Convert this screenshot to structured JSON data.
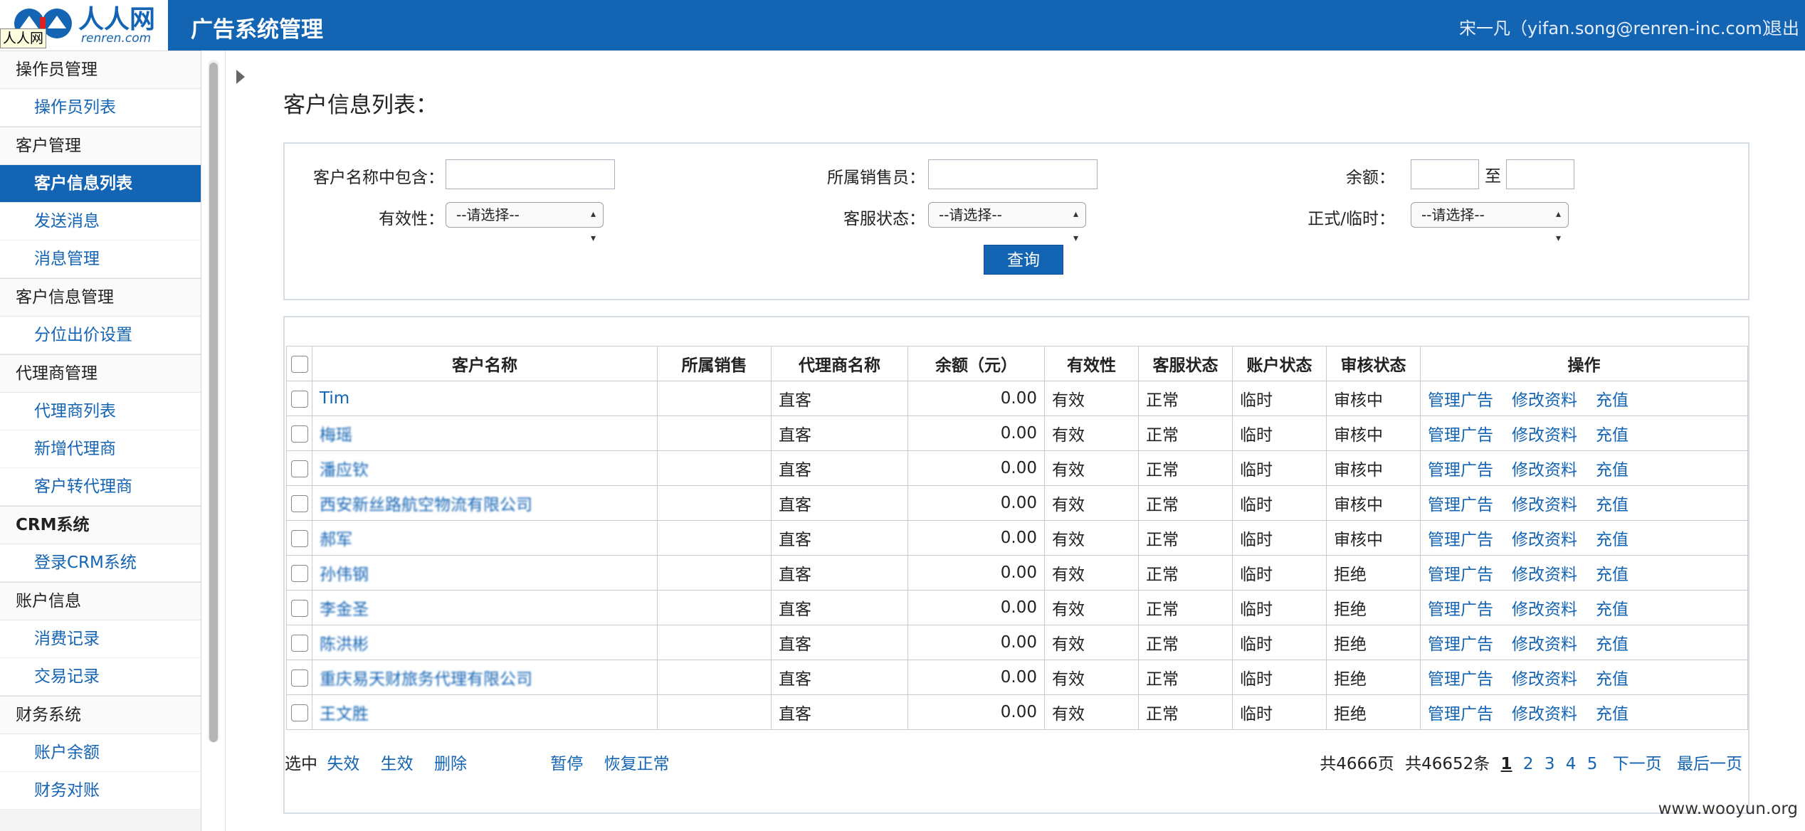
{
  "header": {
    "logo_text": "人人网",
    "logo_sub": "renren.com",
    "logo_tooltip": "人人网",
    "app_title": "广告系统管理",
    "user": "宋一凡（yifan.song@renren-inc.com）",
    "logout": "退出"
  },
  "sidebar": {
    "sections": [
      {
        "title": "操作员管理",
        "items": [
          {
            "label": "操作员列表"
          }
        ]
      },
      {
        "title": "客户管理",
        "items": [
          {
            "label": "客户信息列表",
            "active": true
          },
          {
            "label": "发送消息"
          },
          {
            "label": "消息管理"
          }
        ]
      },
      {
        "title": "客户信息管理",
        "items": [
          {
            "label": "分位出价设置"
          }
        ]
      },
      {
        "title": "代理商管理",
        "items": [
          {
            "label": "代理商列表"
          },
          {
            "label": "新增代理商"
          },
          {
            "label": "客户转代理商"
          }
        ]
      },
      {
        "title": "CRM系统",
        "items": [
          {
            "label": "登录CRM系统"
          }
        ]
      },
      {
        "title": "账户信息",
        "items": [
          {
            "label": "消费记录"
          },
          {
            "label": "交易记录"
          }
        ]
      },
      {
        "title": "财务系统",
        "items": [
          {
            "label": "账户余额"
          },
          {
            "label": "财务对账"
          }
        ]
      }
    ]
  },
  "page_title": "客户信息列表：",
  "search": {
    "name_label": "客户名称中包含：",
    "sales_label": "所属销售员：",
    "balance_label": "余额：",
    "balance_to": "至",
    "validity_label": "有效性：",
    "cs_status_label": "客服状态：",
    "formal_label": "正式/临时：",
    "select_placeholder": "--请选择--",
    "query_button": "查询"
  },
  "table": {
    "headers": [
      "客户名称",
      "所属销售",
      "代理商名称",
      "余额（元）",
      "有效性",
      "客服状态",
      "账户状态",
      "审核状态",
      "操作"
    ],
    "ops": [
      "管理广告",
      "修改资料",
      "充值"
    ],
    "rows": [
      {
        "name": "Tim",
        "sales": "",
        "agent": "直客",
        "balance": "0.00",
        "validity": "有效",
        "cs": "正常",
        "account": "临时",
        "audit": "审核中"
      },
      {
        "name": "梅瑶",
        "sales": "",
        "agent": "直客",
        "balance": "0.00",
        "validity": "有效",
        "cs": "正常",
        "account": "临时",
        "audit": "审核中"
      },
      {
        "name": "潘应钦",
        "sales": "",
        "agent": "直客",
        "balance": "0.00",
        "validity": "有效",
        "cs": "正常",
        "account": "临时",
        "audit": "审核中"
      },
      {
        "name": "西安新丝路航空物流有限公司",
        "sales": "",
        "agent": "直客",
        "balance": "0.00",
        "validity": "有效",
        "cs": "正常",
        "account": "临时",
        "audit": "审核中"
      },
      {
        "name": "郝军",
        "sales": "",
        "agent": "直客",
        "balance": "0.00",
        "validity": "有效",
        "cs": "正常",
        "account": "临时",
        "audit": "审核中"
      },
      {
        "name": "孙伟钢",
        "sales": "",
        "agent": "直客",
        "balance": "0.00",
        "validity": "有效",
        "cs": "正常",
        "account": "临时",
        "audit": "拒绝"
      },
      {
        "name": "李金圣",
        "sales": "",
        "agent": "直客",
        "balance": "0.00",
        "validity": "有效",
        "cs": "正常",
        "account": "临时",
        "audit": "拒绝"
      },
      {
        "name": "陈洪彬",
        "sales": "",
        "agent": "直客",
        "balance": "0.00",
        "validity": "有效",
        "cs": "正常",
        "account": "临时",
        "audit": "拒绝"
      },
      {
        "name": "重庆易天财旅务代理有限公司",
        "sales": "",
        "agent": "直客",
        "balance": "0.00",
        "validity": "有效",
        "cs": "正常",
        "account": "临时",
        "audit": "拒绝"
      },
      {
        "name": "王文胜",
        "sales": "",
        "agent": "直客",
        "balance": "0.00",
        "validity": "有效",
        "cs": "正常",
        "account": "临时",
        "audit": "拒绝"
      }
    ]
  },
  "footer": {
    "selected_label": "选中",
    "actions": [
      "失效",
      "生效",
      "删除"
    ],
    "actions2": [
      "暂停",
      "恢复正常"
    ],
    "total_pages": "共4666页",
    "total_rows": "共46652条",
    "pages": [
      "1",
      "2",
      "3",
      "4",
      "5"
    ],
    "next": "下一页",
    "last": "最后一页"
  },
  "watermark": "www.wooyun.org"
}
